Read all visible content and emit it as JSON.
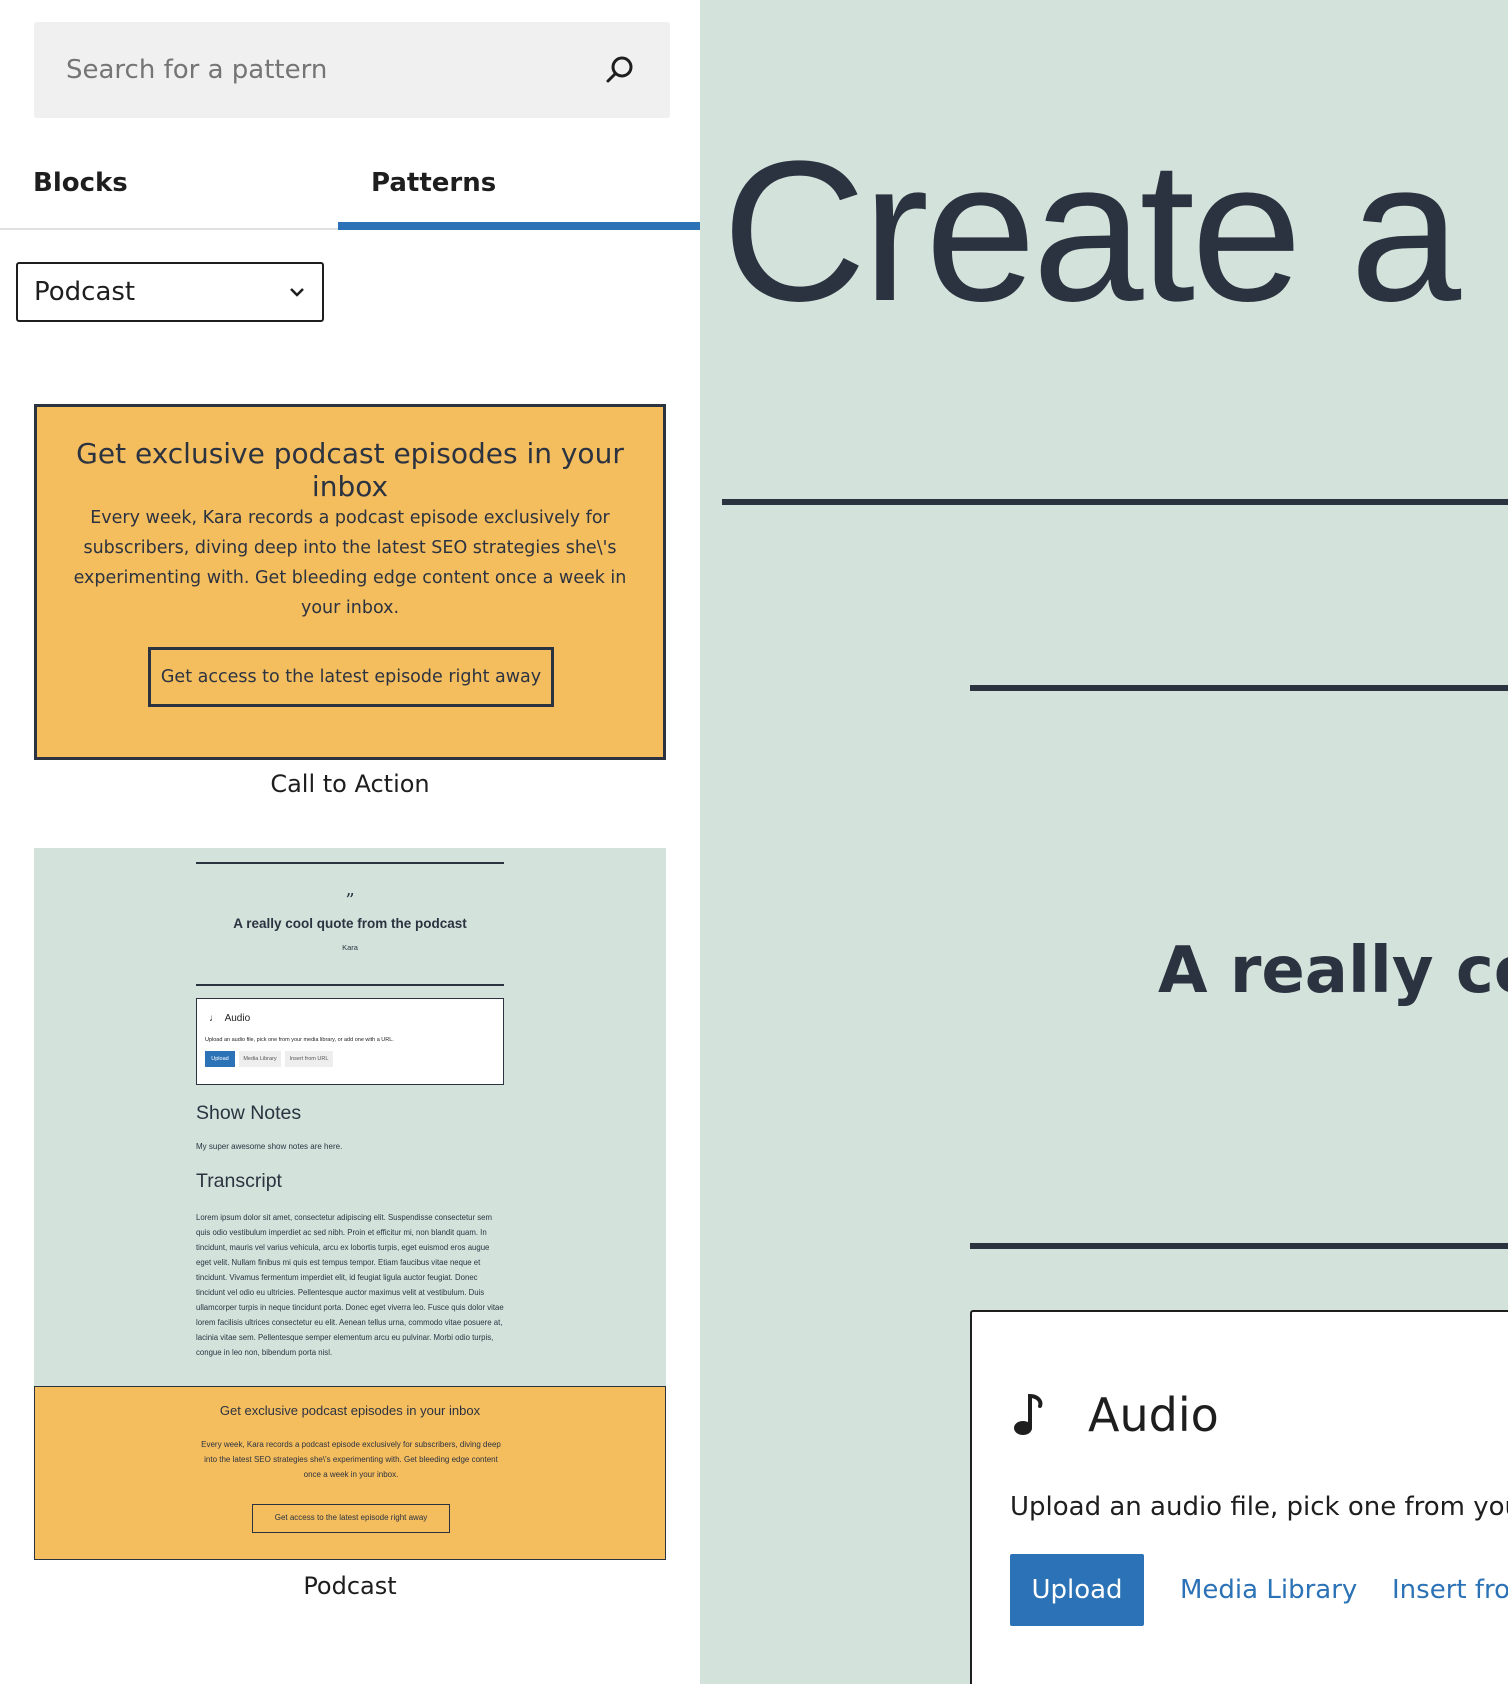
{
  "search": {
    "placeholder": "Search for a pattern"
  },
  "tabs": [
    {
      "label": "Blocks",
      "active": false
    },
    {
      "label": "Patterns",
      "active": true
    }
  ],
  "category_select": {
    "value": "Podcast"
  },
  "patterns": [
    {
      "caption": "Call to Action",
      "title": "Get exclusive podcast episodes in your inbox",
      "body": "Every week, Kara records a podcast episode exclusively for subscribers, diving deep into the latest SEO strategies she\\'s experimenting with. Get bleeding edge content once a week in your inbox.",
      "button": "Get access to the latest episode right away"
    },
    {
      "caption": "Podcast",
      "quote_mark": "”",
      "quote": "A really cool quote from the podcast",
      "quote_cite": "Kara",
      "audio": {
        "title": "Audio",
        "help": "Upload an audio file, pick one from your media library, or add one with a URL.",
        "upload": "Upload",
        "media_library": "Media Library",
        "insert_url": "Insert from URL"
      },
      "show_notes_heading": "Show Notes",
      "show_notes_text": "My super awesome show notes are here.",
      "transcript_heading": "Transcript",
      "transcript_text": "Lorem ipsum dolor sit amet, consectetur adipiscing elit. Suspendisse consectetur sem quis odio vestibulum imperdiet ac sed nibh. Proin et efficitur mi, non blandit quam. In tincidunt, mauris vel varius vehicula, arcu ex lobortis turpis, eget euismod eros augue eget velit. Nullam finibus mi quis est tempus tempor. Etiam faucibus vitae neque et tincidunt. Vivamus fermentum imperdiet elit, id feugiat ligula auctor feugiat. Donec tincidunt vel odio eu ultricies. Pellentesque auctor maximus velit at vestibulum. Duis ullamcorper turpis in neque tincidunt porta. Donec eget viverra leo. Fusce quis dolor vitae lorem facilisis ultrices consectetur eu elit. Aenean tellus urna, commodo vitae posuere at, lacinia vitae sem. Pellentesque semper elementum arcu eu pulvinar. Morbi odio turpis, congue in leo non, bibendum porta nisl.",
      "cta_title": "Get exclusive podcast episodes in your inbox",
      "cta_body": "Every week, Kara records a podcast episode exclusively for subscribers, diving deep into the latest SEO strategies she\\'s experimenting with. Get bleeding edge content once a week in your inbox.",
      "cta_button": "Get access to the latest episode right away"
    }
  ],
  "canvas": {
    "title": "Create a B",
    "quote": "A really cool",
    "audio": {
      "title": "Audio",
      "help": "Upload an audio file, pick one from your m",
      "upload": "Upload",
      "media_library": "Media Library",
      "insert_url": "Insert fror"
    }
  },
  "colors": {
    "accent": "#2c72b6",
    "canvas_bg": "#d3e3dc",
    "cta_bg": "#f4bd5e",
    "text_dark": "#2c3340"
  }
}
